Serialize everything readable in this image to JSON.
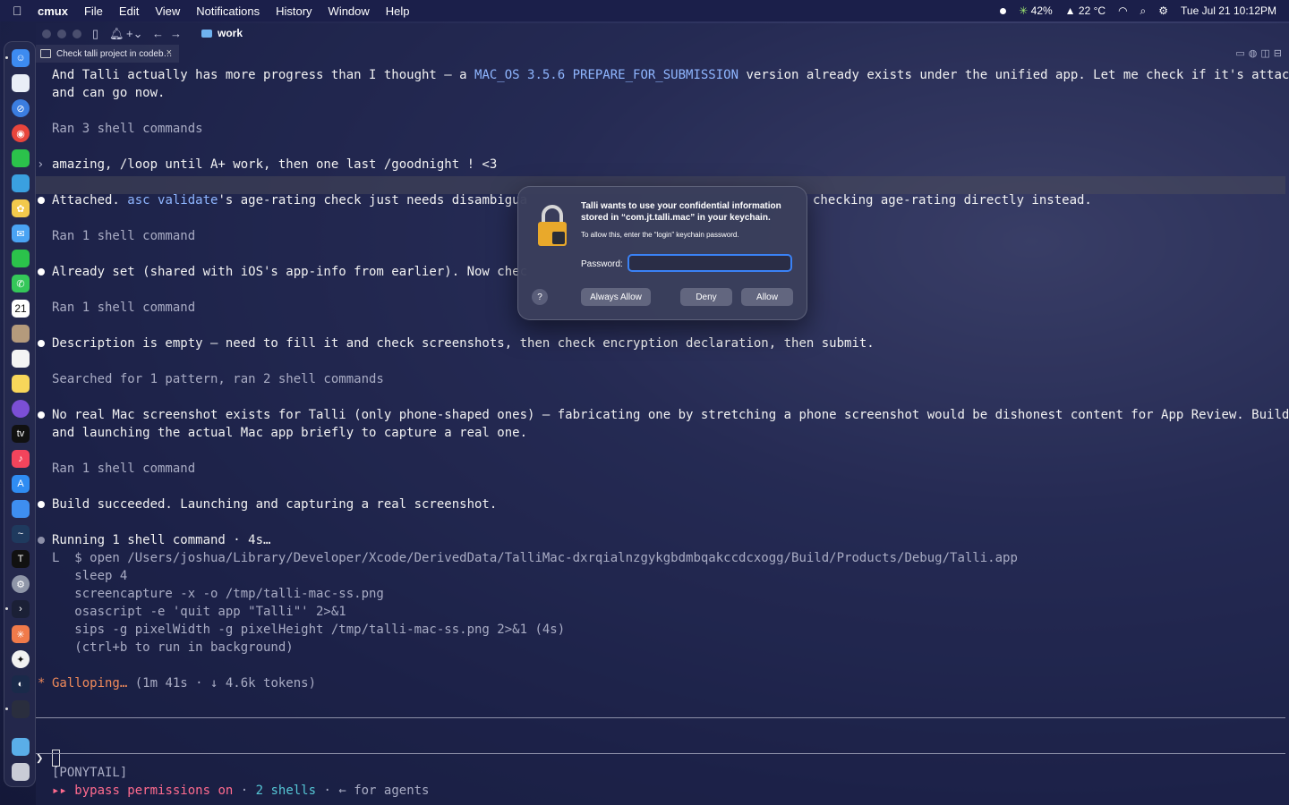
{
  "menubar": {
    "app": "cmux",
    "items": [
      "File",
      "Edit",
      "View",
      "Notifications",
      "History",
      "Window",
      "Help"
    ],
    "battery": "42%",
    "weather": "22 °C",
    "datetime": "Tue Jul 21  10:12PM"
  },
  "window": {
    "workspace_title": "work",
    "tab_title": "Check talli project in codeb…"
  },
  "terminal": {
    "l1a": "And Talli actually has more progress than I thought — a ",
    "l1b": "MAC_OS 3.5.6 PREPARE_FOR_SUBMISSION",
    "l1c": " version already exists under the unified app. Let me check if it's attached",
    "l2": "and can go now.",
    "ran3": "Ran 3 shell commands",
    "prompt": "amazing, /loop until A+ work, then one last /goodnight ! <3",
    "attached_a": "Attached. ",
    "attached_b": "asc validate",
    "attached_c": "'s age-rating check just needs disambigua",
    "attached_d": "checking age-rating directly instead.",
    "ran1a": "Ran 1 shell command",
    "already": "Already set (shared with iOS's app-info from earlier). Now chec",
    "ran1b": "Ran 1 shell command",
    "desc": "Description is empty — need to fill it and check screenshots, then check encryption declaration, then submit.",
    "searched": "Searched for 1 pattern, ran 2 shell commands",
    "noreal1": "No real Mac screenshot exists for Talli (only phone-shaped ones) — fabricating one by stretching a phone screenshot would be dishonest content for App Review. Building",
    "noreal2": "and launching the actual Mac app briefly to capture a real one.",
    "ran1c": "Ran 1 shell command",
    "build": "Build succeeded. Launching and capturing a real screenshot.",
    "running": "Running 1 shell command · 4s…",
    "cmd1": "L  $ open /Users/joshua/Library/Developer/Xcode/DerivedData/TalliMac-dxrqialnzgykgbdmbqakccdcxogg/Build/Products/Debug/Talli.app",
    "cmd2": "   sleep 4",
    "cmd3": "   screencapture -x -o /tmp/talli-mac-ss.png",
    "cmd4": "   osascript -e 'quit app \"Talli\"' 2>&1",
    "cmd5": "   sips -g pixelWidth -g pixelHeight /tmp/talli-mac-ss.png 2>&1 (4s)",
    "cmd6": "   (ctrl+b to run in background)",
    "galloping_star": "*",
    "galloping": "Galloping…",
    "galloping_meta": " (1m 41s · ↓ 4.6k tokens)",
    "input_prompt": "❯",
    "ponytail": "[PONYTAIL]",
    "bypass_arrows": "▸▸",
    "bypass": "bypass permissions on",
    "sep1": " · ",
    "shells": "2 shells",
    "agents": " · ← for agents"
  },
  "dialog": {
    "title": "Talli wants to use your confidential information stored in “com.jt.talli.mac” in your keychain.",
    "subtitle": "To allow this, enter the “login” keychain password.",
    "password_label": "Password:",
    "password_value": "",
    "help": "?",
    "always_allow": "Always Allow",
    "deny": "Deny",
    "allow": "Allow"
  },
  "dock": {
    "calendar_day": "21"
  },
  "colors": {
    "accent_blue": "#3a82f6",
    "link": "#8fb6ff",
    "orange": "#f08a5a",
    "pink": "#ff6b8e",
    "cyan": "#56c7d6"
  }
}
